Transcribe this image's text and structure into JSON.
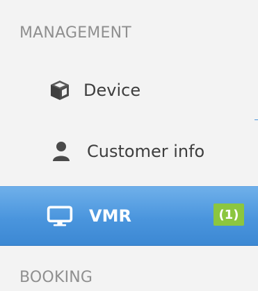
{
  "sidebar": {
    "sections": [
      {
        "header": "MANAGEMENT",
        "items": [
          {
            "label": "Device",
            "icon": "cube-icon",
            "active": false
          },
          {
            "label": "Customer info",
            "icon": "user-icon",
            "active": false
          },
          {
            "label": "VMR",
            "icon": "monitor-icon",
            "active": true,
            "badge": "(1)"
          }
        ]
      },
      {
        "header": "BOOKING",
        "items": []
      }
    ],
    "colors": {
      "active_background": "#4a95dd",
      "badge_background": "#8cc63f",
      "header_text": "#8f8f8f",
      "item_text": "#3e3e3e"
    }
  }
}
